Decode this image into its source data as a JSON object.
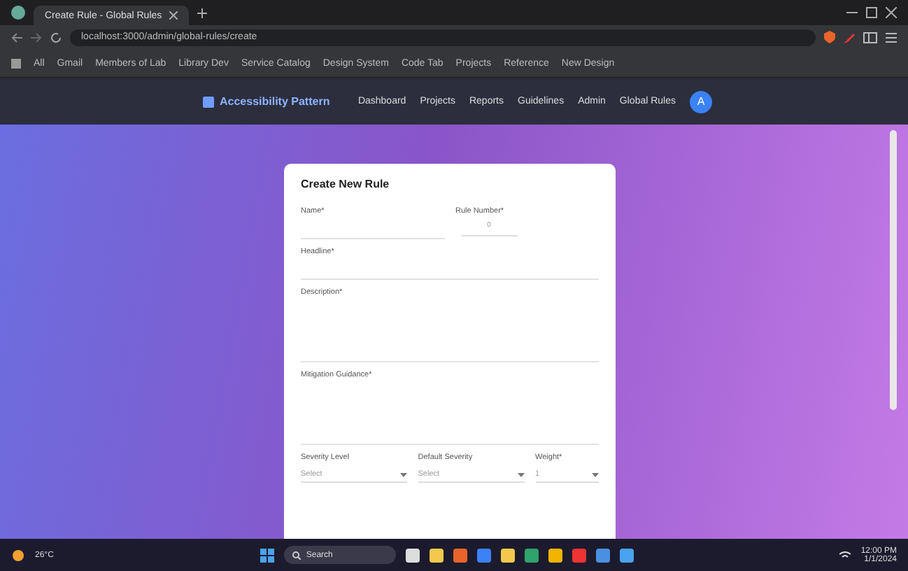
{
  "browser": {
    "tab_title": "Create Rule - Global Rules",
    "url": "localhost:3000/admin/global-rules/create",
    "bookmarks": [
      "All",
      "Gmail",
      "Members of Lab",
      "Library Dev",
      "Service Catalog",
      "Design System",
      "Code Tab",
      "Projects",
      "Reference",
      "New Design"
    ]
  },
  "site": {
    "brand": "Accessibility Pattern",
    "nav": [
      "Dashboard",
      "Projects",
      "Reports",
      "Guidelines",
      "Admin",
      "Global Rules"
    ],
    "avatar": "A"
  },
  "form": {
    "title": "Create New Rule",
    "fields": [
      {
        "kind": "text",
        "label": "Name*"
      },
      {
        "kind": "number",
        "label": "Rule Number*",
        "value": "0"
      },
      {
        "kind": "text",
        "label": "Headline*"
      },
      {
        "kind": "textarea",
        "label": "Description*"
      },
      {
        "kind": "textarea",
        "label": "Mitigation Guidance*"
      }
    ],
    "bottom": [
      {
        "label": "Severity Level",
        "value": "Select"
      },
      {
        "label": "Default Severity",
        "value": "Select"
      },
      {
        "label": "Weight*",
        "value": "1"
      }
    ]
  },
  "taskbar": {
    "weather": "26°C",
    "search": "Search",
    "time": "12:00 PM",
    "date": "1/1/2024"
  }
}
